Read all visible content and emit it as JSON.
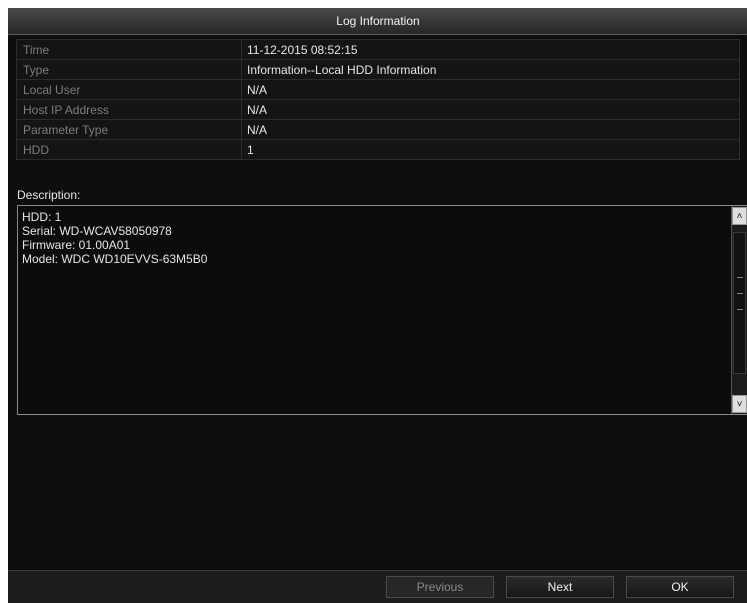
{
  "dialog": {
    "title": "Log Information"
  },
  "fields": [
    {
      "label": "Time",
      "value": "11-12-2015 08:52:15"
    },
    {
      "label": "Type",
      "value": "Information--Local HDD Information"
    },
    {
      "label": "Local User",
      "value": "N/A"
    },
    {
      "label": "Host IP Address",
      "value": "N/A"
    },
    {
      "label": "Parameter Type",
      "value": "N/A"
    },
    {
      "label": "HDD",
      "value": "1"
    }
  ],
  "description": {
    "label": "Description:",
    "lines": [
      "HDD: 1",
      "Serial: WD-WCAV58050978",
      "Firmware: 01.00A01",
      "Model: WDC WD10EVVS-63M5B0"
    ]
  },
  "scrollbar": {
    "up_icon": "chevron-up-icon",
    "down_icon": "chevron-down-icon",
    "up_glyph": "˄",
    "down_glyph": "˅"
  },
  "buttons": {
    "previous_label": "Previous",
    "next_label": "Next",
    "ok_label": "OK"
  }
}
